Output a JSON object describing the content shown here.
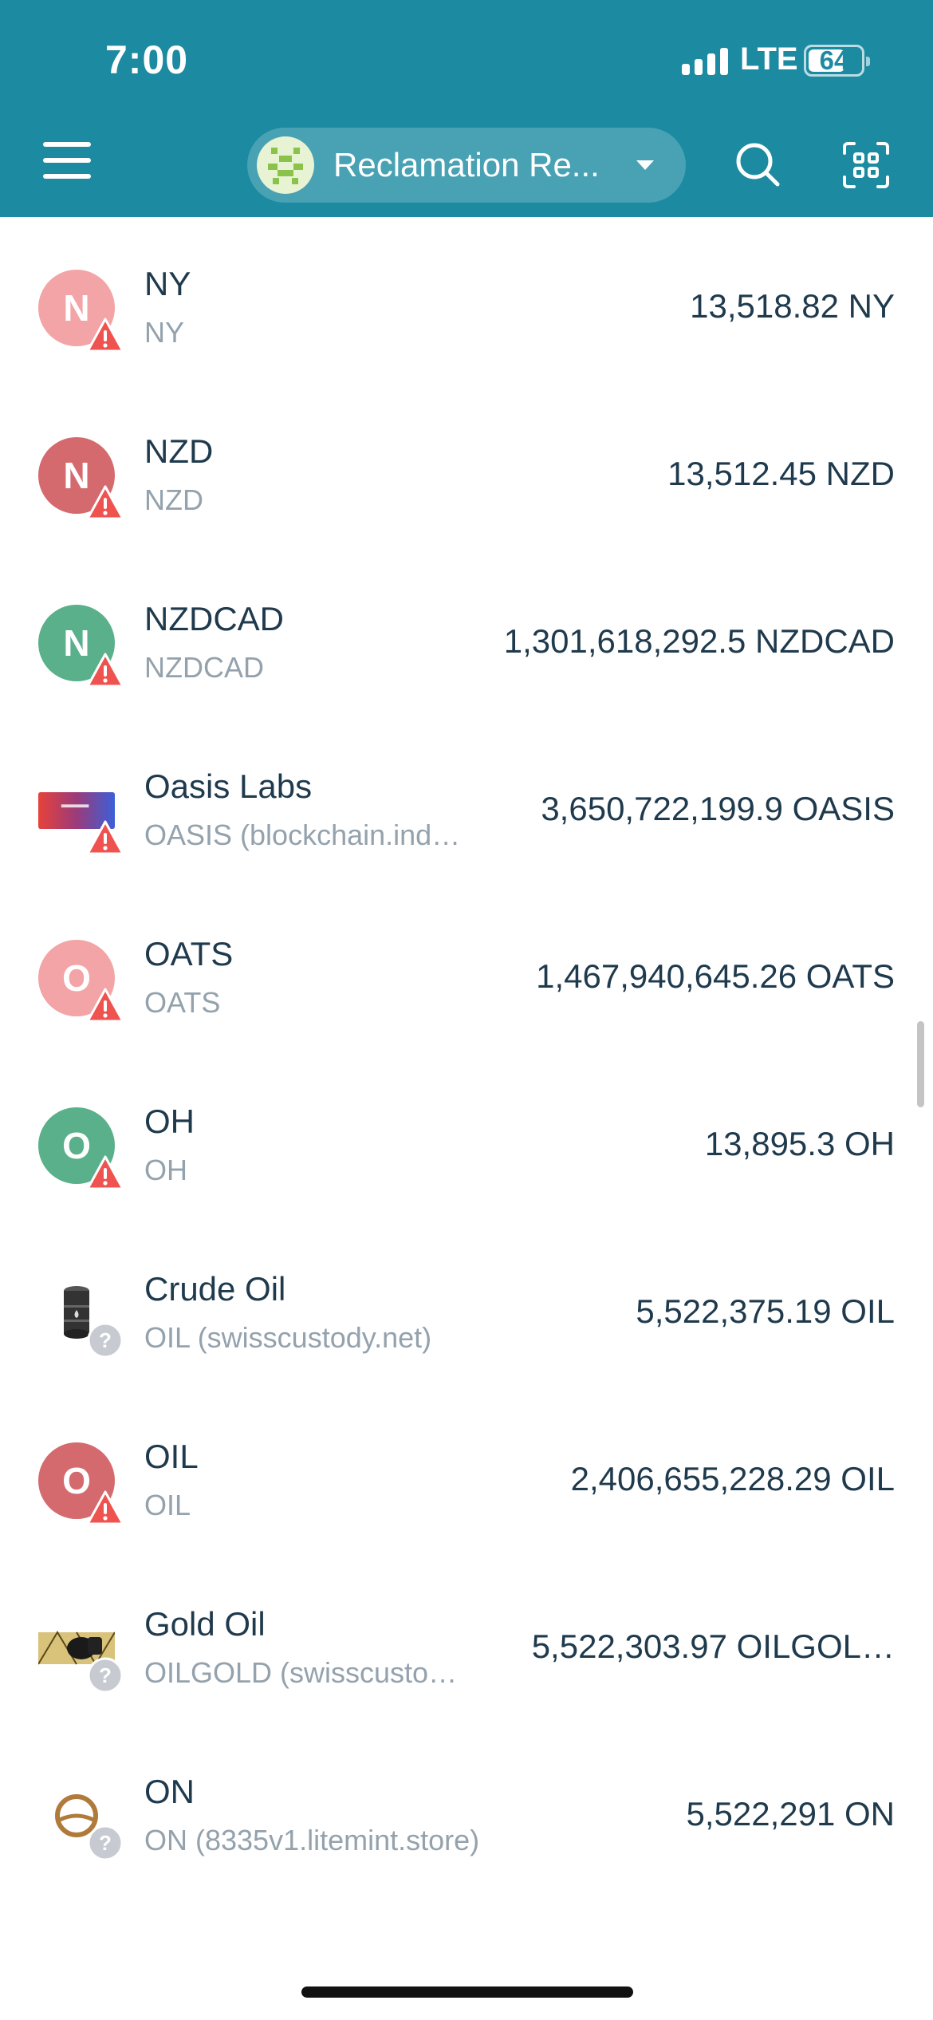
{
  "status_bar": {
    "time": "7:00",
    "network": "LTE",
    "battery": "64"
  },
  "header": {
    "account_name": "Reclamation Re...",
    "menu_icon": "hamburger-menu-icon",
    "search_icon": "search-icon",
    "scan_icon": "qr-scan-icon"
  },
  "colors": {
    "header_bg": "#1c8aa0",
    "pill_bg": "#48a2b4",
    "warning": "#ef5350",
    "unknown": "#c7cbd1"
  },
  "assets": [
    {
      "name": "NY",
      "sub": "NY",
      "amount": "13,518.82 NY",
      "letter": "N",
      "color": "#f3a4a6",
      "badge": "warning"
    },
    {
      "name": "NZD",
      "sub": "NZD",
      "amount": "13,512.45 NZD",
      "letter": "N",
      "color": "#d46a6d",
      "badge": "warning"
    },
    {
      "name": "NZDCAD",
      "sub": "NZDCAD",
      "amount": "1,301,618,292.5 NZDCAD",
      "letter": "N",
      "color": "#59b08a",
      "badge": "warning"
    },
    {
      "name": "Oasis Labs",
      "sub": "OASIS (blockchain.ind…",
      "amount": "3,650,722,199.9 OASIS",
      "letter": "",
      "color": "",
      "badge": "warning",
      "image": "oasis-card"
    },
    {
      "name": "OATS",
      "sub": "OATS",
      "amount": "1,467,940,645.26 OATS",
      "letter": "O",
      "color": "#f3a4a6",
      "badge": "warning"
    },
    {
      "name": "OH",
      "sub": "OH",
      "amount": "13,895.3 OH",
      "letter": "O",
      "color": "#59b08a",
      "badge": "warning"
    },
    {
      "name": "Crude Oil",
      "sub": "OIL (swisscustody.net)",
      "amount": "5,522,375.19 OIL",
      "letter": "",
      "color": "",
      "badge": "unknown",
      "image": "oil-barrel"
    },
    {
      "name": "OIL",
      "sub": "OIL",
      "amount": "2,406,655,228.29 OIL",
      "letter": "O",
      "color": "#d46a6d",
      "badge": "warning"
    },
    {
      "name": "Gold Oil",
      "sub": "OILGOLD (swisscusto…",
      "amount": "5,522,303.97 OILGOL…",
      "letter": "",
      "color": "",
      "badge": "unknown",
      "image": "gold-oil"
    },
    {
      "name": "ON",
      "sub": "ON (8335v1.litemint.store)",
      "amount": "5,522,291 ON",
      "letter": "",
      "color": "",
      "badge": "unknown",
      "image": "on-ring"
    }
  ]
}
